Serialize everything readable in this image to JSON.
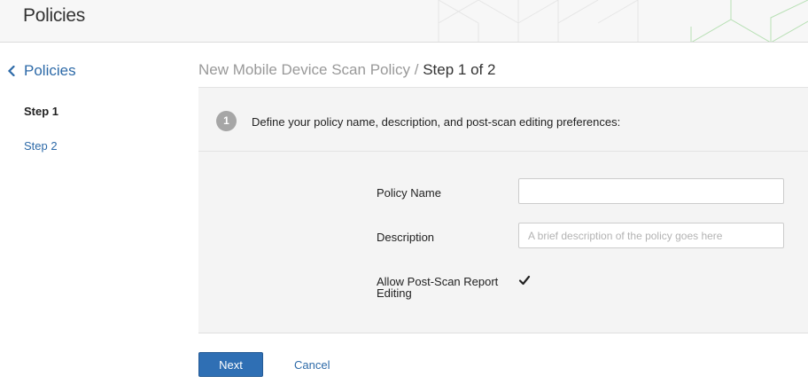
{
  "header": {
    "app_title": "Policies"
  },
  "sidebar": {
    "back_label": "Policies",
    "steps": [
      {
        "label": "Step 1",
        "active": true
      },
      {
        "label": "Step 2",
        "active": false
      }
    ]
  },
  "main": {
    "title_crumb": "New Mobile Device Scan Policy",
    "title_sep": " / ",
    "title_current": "Step 1 of 2",
    "section": {
      "step_number": "1",
      "instructions": "Define your policy name, description, and post-scan editing preferences:"
    },
    "form": {
      "name_label": "Policy Name",
      "name_value": "",
      "description_label": "Description",
      "description_placeholder": "A brief description of the policy goes here",
      "allow_label": "Allow Post-Scan Report Editing",
      "allow_checked": true
    },
    "actions": {
      "next_label": "Next",
      "cancel_label": "Cancel"
    }
  },
  "colors": {
    "link": "#2d6aa8",
    "primary_button": "#2f6fb4",
    "header_accent": "#8fd18a"
  }
}
